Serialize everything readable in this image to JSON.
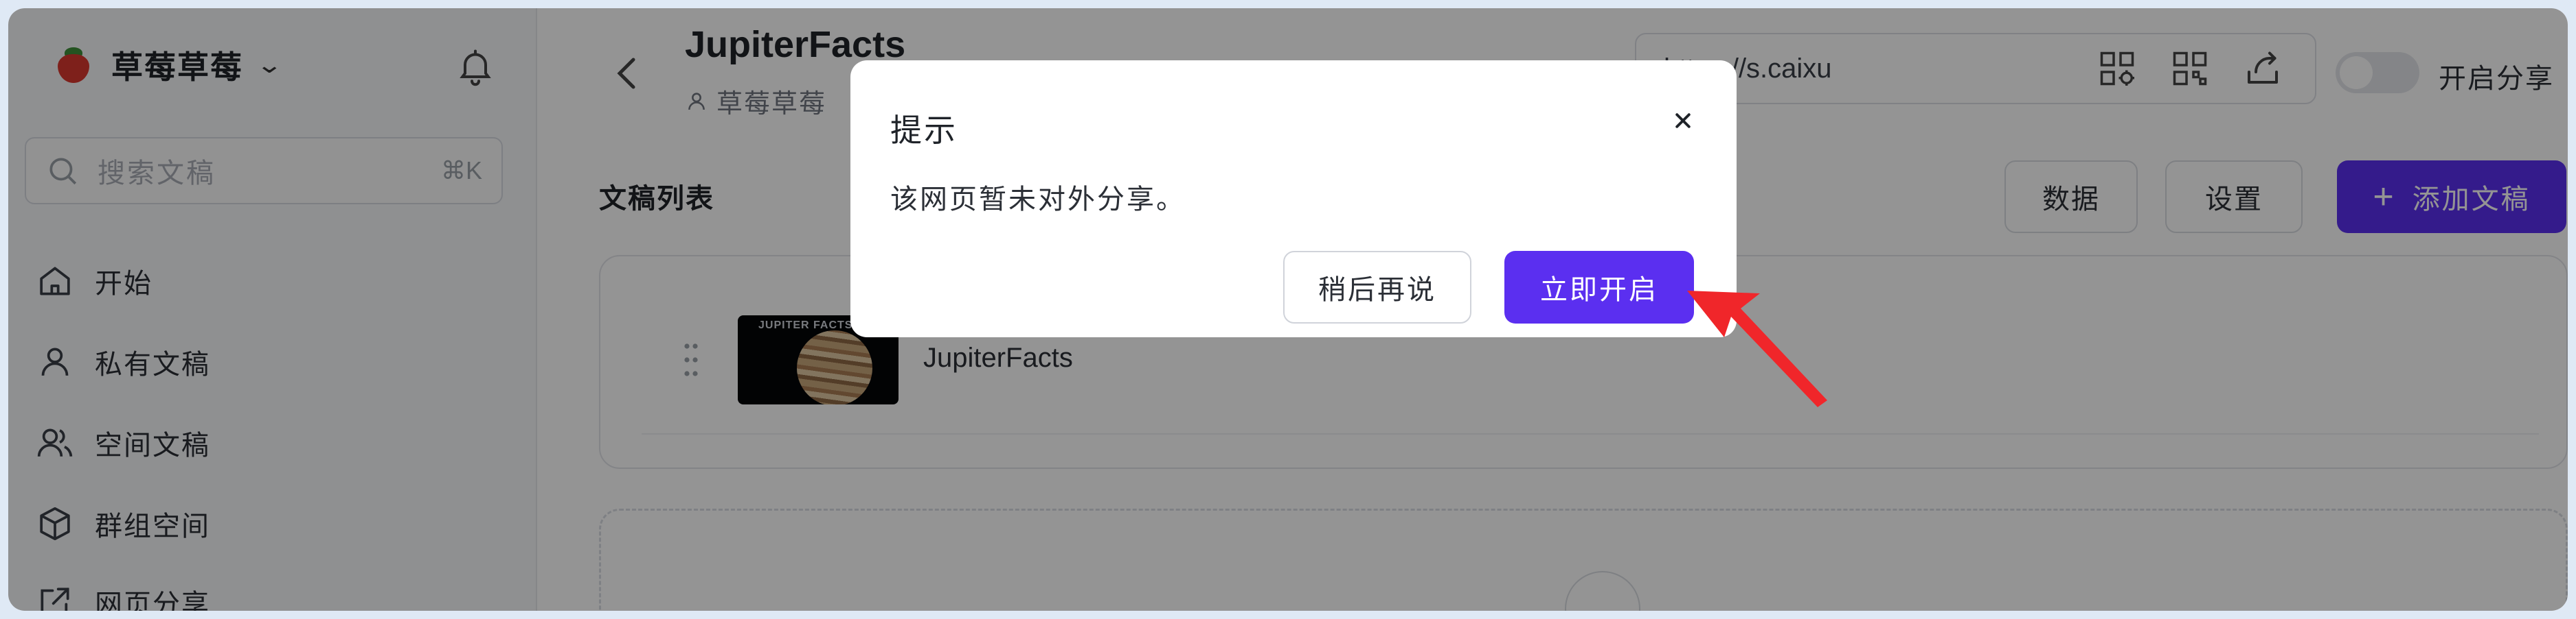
{
  "sidebar": {
    "workspace_name": "草莓草莓",
    "search": {
      "placeholder": "搜索文稿",
      "shortcut": "⌘K"
    },
    "items": [
      {
        "label": "开始",
        "icon": "home-icon"
      },
      {
        "label": "私有文稿",
        "icon": "user-icon"
      },
      {
        "label": "空间文稿",
        "icon": "users-icon"
      },
      {
        "label": "群组空间",
        "icon": "cube-icon"
      },
      {
        "label": "网页分享",
        "icon": "external-link-icon"
      }
    ]
  },
  "header": {
    "title": "JupiterFacts",
    "owner": "草莓草莓",
    "url": "https://s.caixu",
    "share_toggle_label": "开启分享",
    "share_enabled": false
  },
  "main": {
    "list_title": "文稿列表",
    "buttons": {
      "data": "数据",
      "settings": "设置",
      "add": "添加文稿"
    },
    "documents": [
      {
        "title": "JupiterFacts",
        "thumbnail_text": "JUPITER FACTS"
      }
    ],
    "add_symbol": "+"
  },
  "dialog": {
    "title": "提示",
    "close_symbol": "×",
    "message": "该网页暂未对外分享。",
    "later_label": "稍后再说",
    "enable_label": "立即开启"
  },
  "colors": {
    "accent": "#5b2ff0",
    "annotation_arrow": "#f0262a",
    "overlay": "rgba(0,0,0,0.42)"
  }
}
